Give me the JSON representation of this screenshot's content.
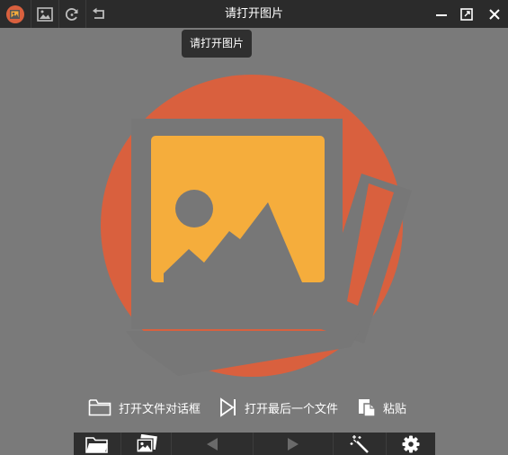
{
  "window": {
    "title": "请打开图片",
    "tooltip": "请打开图片"
  },
  "toolbar": {
    "icons": [
      "app-logo-icon",
      "gallery-icon",
      "refresh-icon",
      "undo-icon"
    ]
  },
  "window_controls": [
    "minimize-icon",
    "restore-icon",
    "close-icon"
  ],
  "actions": {
    "open_dialog": "打开文件对话框",
    "open_last": "打开最后一个文件",
    "paste": "粘贴"
  },
  "bottom_toolbar": {
    "icons": [
      "folder-icon",
      "images-icon",
      "prev-arrow-icon",
      "next-arrow-icon",
      "magic-wand-icon",
      "settings-gear-icon"
    ]
  },
  "colors": {
    "background": "#7a7a7a",
    "titlebar": "#2b2b2b",
    "accent_orange": "#d9603e",
    "photo_yellow": "#f5ad3c",
    "frame_gray": "#777777"
  }
}
